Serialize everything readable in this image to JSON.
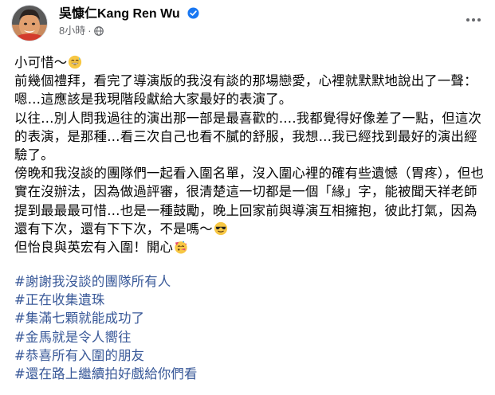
{
  "author": {
    "name": "吳慷仁Kang Ren Wu",
    "verified_icon": "verified-badge-icon",
    "avatar_icon": "profile-photo"
  },
  "meta": {
    "time": "8小時",
    "separator": "·",
    "audience_icon": "globe-icon"
  },
  "more_icon": "more-options-icon",
  "post": {
    "lines": [
      {
        "text": "小可惜～",
        "emoji": "grinning-sweat-emoji"
      },
      {
        "text": "前幾個禮拜，看完了導演版的我沒有談的那場戀愛，心裡就默默地說出了一聲：嗯…這應該是我現階段獻給大家最好的表演了。"
      },
      {
        "text": "以往…別人問我過往的演出那一部是最喜歡的….我都覺得好像差了一點，但這次的表演，是那種…看三次自己也看不膩的舒服，我想…我已經找到最好的演出經驗了。"
      },
      {
        "text": "傍晚和我沒談的團隊們一起看入圍名單，沒入圍心裡的確有些遺憾（胃疼），但也實在沒辦法，因為做過評審，很清楚這一切都是一個「緣」字，能被聞天祥老師提到最最最可惜…也是一種鼓勵，晚上回家前與導演互相擁抱，彼此打氣，因為還有下次，還有下下次，不是嗎～",
        "emoji": "sunglasses-emoji"
      },
      {
        "text": "但怡良與英宏有入圍！開心",
        "emoji": "partying-face-emoji"
      }
    ]
  },
  "hashtags": [
    "#謝謝我沒談的團隊所有人",
    "#正在收集遺珠",
    "#集滿七顆就能成功了",
    "#金馬就是令人嚮往",
    "#恭喜所有入圍的朋友",
    "#還在路上繼續拍好戲給你們看"
  ],
  "colors": {
    "text": "#050505",
    "secondary": "#65676b",
    "link": "#385898",
    "verified": "#1877f2"
  }
}
